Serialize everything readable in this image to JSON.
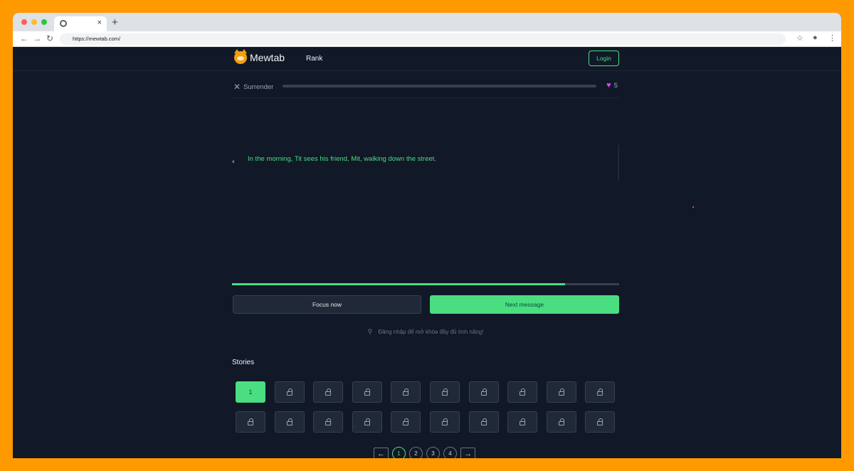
{
  "browser": {
    "url": "https://mewtab.com/",
    "tab_close": "×",
    "new_tab": "+"
  },
  "header": {
    "logo_text": "Mewtab",
    "rank_label": "Rank",
    "login_label": "Login"
  },
  "toolbar": {
    "surrender_label": "Surrender",
    "lives": "5"
  },
  "message": {
    "text": "In the morning, Tit sees his friend, Mit, walking down the street."
  },
  "progress": {
    "fraction": 0.86
  },
  "actions": {
    "focus_label": "Focus now",
    "next_label": "Next message"
  },
  "hint": "Đăng nhập để mở khóa đầy đủ tính năng!",
  "stories": {
    "title": "Stories",
    "items": [
      {
        "label": "1",
        "locked": false,
        "active": true
      },
      {
        "locked": true
      },
      {
        "locked": true
      },
      {
        "locked": true
      },
      {
        "locked": true
      },
      {
        "locked": true
      },
      {
        "locked": true
      },
      {
        "locked": true
      },
      {
        "locked": true
      },
      {
        "locked": true
      },
      {
        "locked": true
      },
      {
        "locked": true
      },
      {
        "locked": true
      },
      {
        "locked": true
      },
      {
        "locked": true
      },
      {
        "locked": true
      },
      {
        "locked": true
      },
      {
        "locked": true
      },
      {
        "locked": true
      },
      {
        "locked": true
      }
    ]
  },
  "pagination": {
    "pages": [
      "1",
      "2",
      "3",
      "4"
    ],
    "current": "1"
  },
  "colors": {
    "accent": "#4ade80",
    "background": "#111827",
    "heart": "#d946ef"
  }
}
